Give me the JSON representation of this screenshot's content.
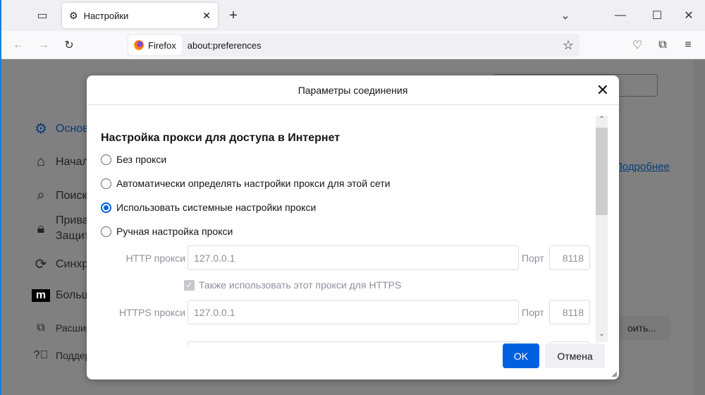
{
  "browser": {
    "tab_title": "Настройки",
    "identity": "Firefox",
    "url": "about:preferences"
  },
  "sidebar": {
    "items": [
      {
        "label": "Основ",
        "icon": "gear-icon"
      },
      {
        "label": "Начал",
        "icon": "home-icon"
      },
      {
        "label": "Поиск",
        "icon": "search-icon"
      },
      {
        "label": "Прива",
        "label2": "Защит",
        "icon": "lock-icon"
      },
      {
        "label": "Синхр",
        "icon": "sync-icon"
      },
      {
        "label": "Больш",
        "icon": "mozilla-icon"
      },
      {
        "label": "Расшир",
        "icon": "extension-icon"
      },
      {
        "label": "Поддер",
        "icon": "help-icon"
      }
    ]
  },
  "background": {
    "link": "Подробнее",
    "button": "оить..."
  },
  "dialog": {
    "title": "Параметры соединения",
    "heading": "Настройка прокси для доступа в Интернет",
    "options": [
      "Без прокси",
      "Автоматически определять настройки прокси для этой сети",
      "Использовать системные настройки прокси",
      "Ручная настройка прокси"
    ],
    "selected_index": 2,
    "http_label": "HTTP прокси",
    "http_value": "127.0.0.1",
    "port_label": "Порт",
    "http_port": "8118",
    "also_https": "Также использовать этот прокси для HTTPS",
    "https_label": "HTTPS прокси",
    "https_value": "127.0.0.1",
    "https_port": "8118",
    "ok": "OK",
    "cancel": "Отмена"
  },
  "colors": {
    "accent": "#0061e0",
    "overlay": "#808080"
  }
}
